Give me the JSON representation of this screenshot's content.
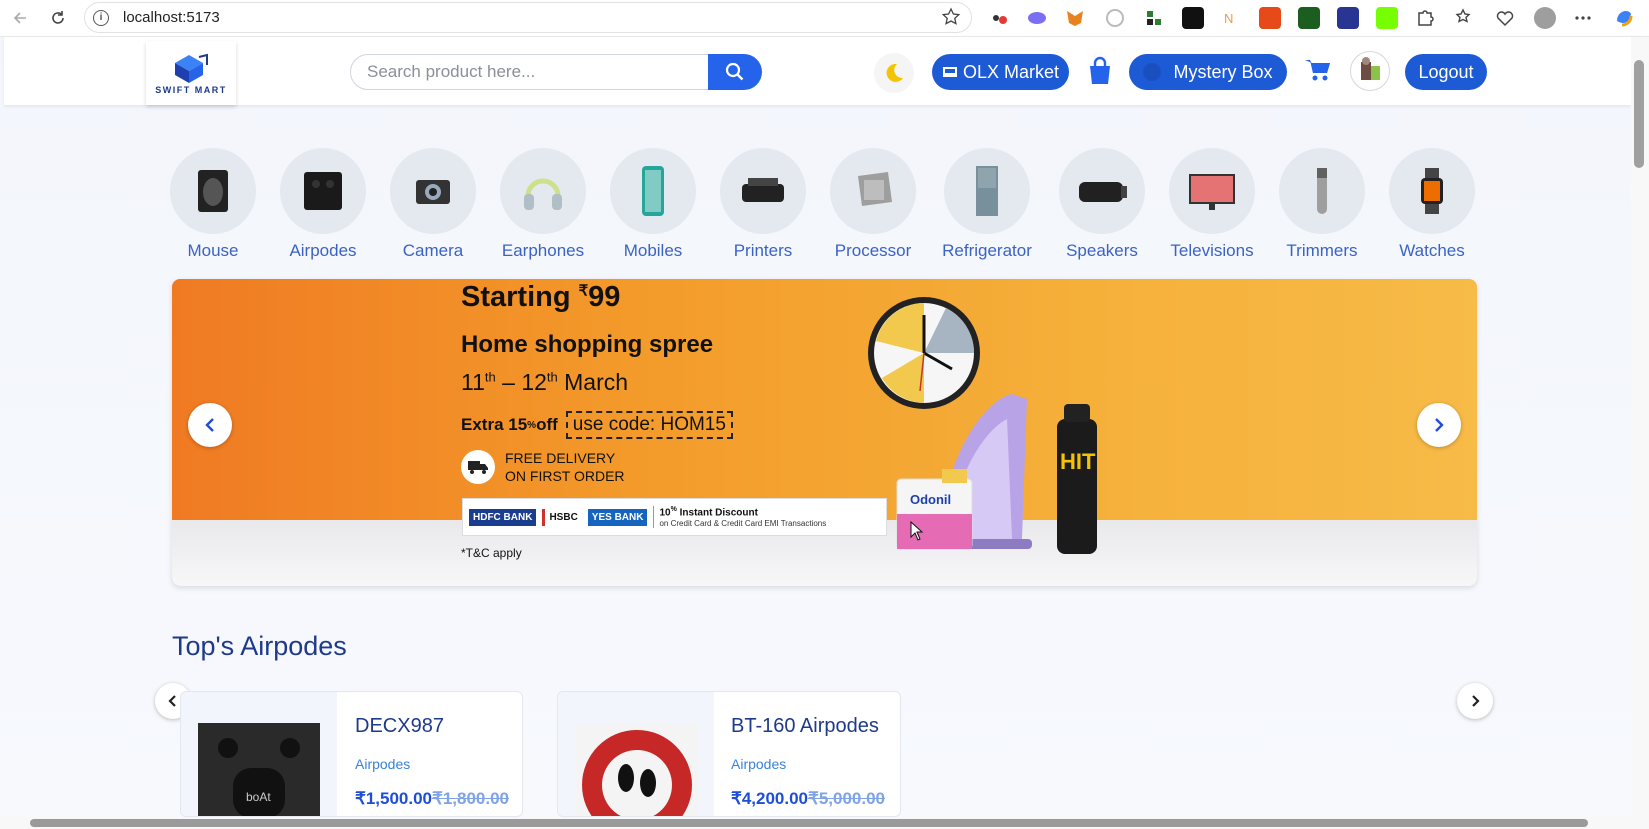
{
  "browser": {
    "url": "localhost:5173"
  },
  "header": {
    "logo_text": "SWIFT MART",
    "search_placeholder": "Search product here...",
    "olx_label": "OLX Market",
    "mystery_label": "Mystery Box",
    "logout_label": "Logout"
  },
  "categories": [
    {
      "label": "Mouse"
    },
    {
      "label": "Airpodes"
    },
    {
      "label": "Camera"
    },
    {
      "label": "Earphones"
    },
    {
      "label": "Mobiles"
    },
    {
      "label": "Printers"
    },
    {
      "label": "Processor"
    },
    {
      "label": "Refrigerator"
    },
    {
      "label": "Speakers"
    },
    {
      "label": "Televisions"
    },
    {
      "label": "Trimmers"
    },
    {
      "label": "Watches"
    }
  ],
  "banner": {
    "starting": "Starting",
    "currency": "₹",
    "price": "99",
    "headline": "Home shopping spree",
    "date_d1": "11",
    "date_sup1": "th",
    "date_sep": " – ",
    "date_d2": "12",
    "date_sup2": "th",
    "date_month": " March",
    "extra_prefix": "Extra 15",
    "extra_sup": "%",
    "extra_suffix": " off",
    "code": "use code: HOM15",
    "delivery_1": "FREE DELIVERY",
    "delivery_2": "ON FIRST ORDER",
    "bank1": "HDFC BANK",
    "bank2": "HSBC",
    "bank3": "YES BANK",
    "instant_main": "10",
    "instant_sup": "%",
    "instant_label": " Instant Discount",
    "instant_sub": "on Credit Card & Credit Card EMI Transactions",
    "tc": "*T&C apply"
  },
  "section": {
    "title": "Top's Airpodes"
  },
  "products": [
    {
      "name": "DECX987",
      "category": "Airpodes",
      "price": "₹1,500.00",
      "old_price": "₹1,800.00"
    },
    {
      "name": "BT-160 Airpodes",
      "category": "Airpodes",
      "price": "₹4,200.00",
      "old_price": "₹5,000.00"
    }
  ]
}
